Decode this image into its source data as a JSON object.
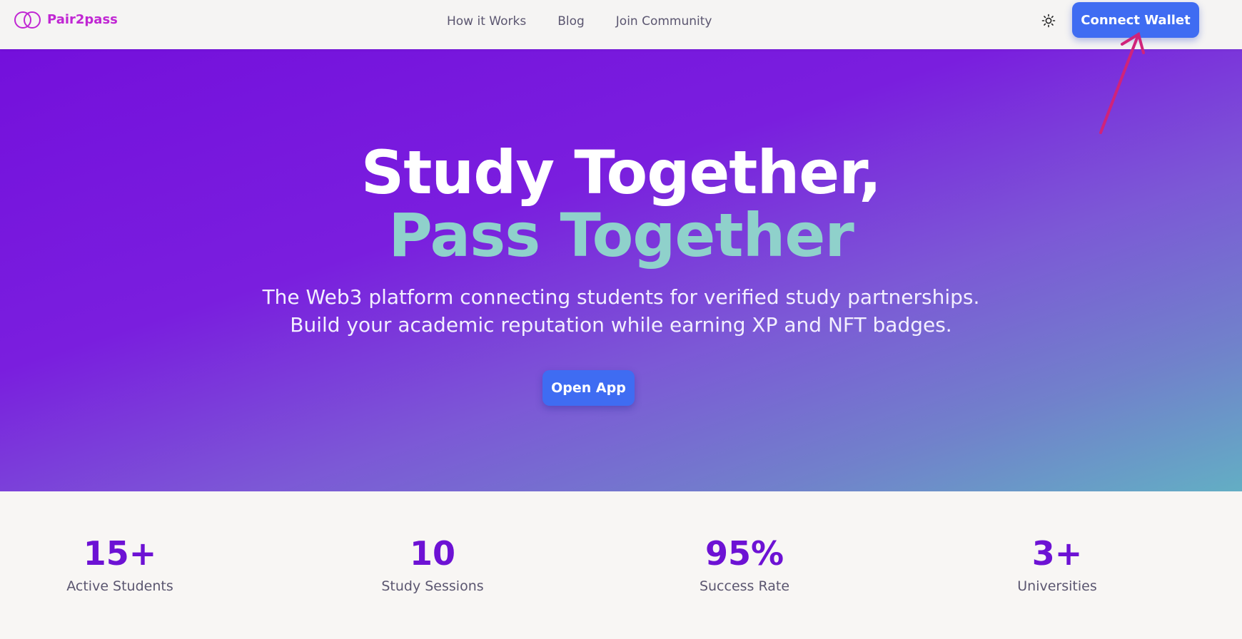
{
  "brand": {
    "name": "Pair2pass",
    "color": "#c026d3"
  },
  "nav": {
    "links": [
      "How it Works",
      "Blog",
      "Join Community"
    ],
    "theme_icon": "sun-icon",
    "connect_label": "Connect Wallet"
  },
  "hero": {
    "title_line1": "Study Together,",
    "title_line2": "Pass Together",
    "subtitle_line1": "The Web3 platform connecting students for verified study partnerships.",
    "subtitle_line2": "Build your academic reputation while earning XP and NFT badges.",
    "cta_label": "Open App"
  },
  "stats": [
    {
      "value": "15+",
      "label": "Active Students"
    },
    {
      "value": "10",
      "label": "Study Sessions"
    },
    {
      "value": "95%",
      "label": "Success Rate"
    },
    {
      "value": "3+",
      "label": "Universities"
    }
  ],
  "colors": {
    "accent": "#3f6cf2",
    "stat_value": "#6d12d4",
    "title_teal": "#8fd1cb",
    "annotation_arrow": "#d0237a"
  }
}
